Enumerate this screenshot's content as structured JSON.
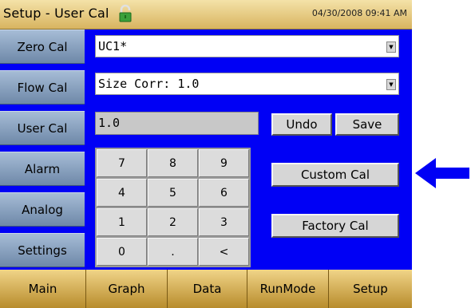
{
  "header": {
    "title": "Setup - User Cal",
    "datetime": "04/30/2008 09:41 AM"
  },
  "sidebar": {
    "items": [
      {
        "label": "Zero Cal"
      },
      {
        "label": "Flow Cal"
      },
      {
        "label": "User Cal"
      },
      {
        "label": "Alarm"
      },
      {
        "label": "Analog"
      },
      {
        "label": "Settings"
      }
    ]
  },
  "main": {
    "cal_select": {
      "value": "UC1*"
    },
    "size_corr_select": {
      "value": "Size Corr: 1.0"
    },
    "value_field": {
      "value": "1.0"
    },
    "undo_label": "Undo",
    "save_label": "Save",
    "custom_cal_label": "Custom Cal",
    "factory_cal_label": "Factory Cal",
    "keypad": [
      "7",
      "8",
      "9",
      "4",
      "5",
      "6",
      "1",
      "2",
      "3",
      "0",
      ".",
      "<"
    ]
  },
  "tabs": [
    {
      "label": "Main"
    },
    {
      "label": "Graph"
    },
    {
      "label": "Data"
    },
    {
      "label": "RunMode"
    },
    {
      "label": "Setup"
    }
  ],
  "colors": {
    "screen_bg": "#0000f5",
    "title_bar": "#e8cc80",
    "tab_bar": "#d4ac54",
    "side_menu": "#8aa2c0",
    "callout_arrow": "#0000f5"
  },
  "icons": {
    "lock": "lock-icon",
    "dropdown": "chevron-down-icon",
    "callout": "arrow-left-icon"
  }
}
